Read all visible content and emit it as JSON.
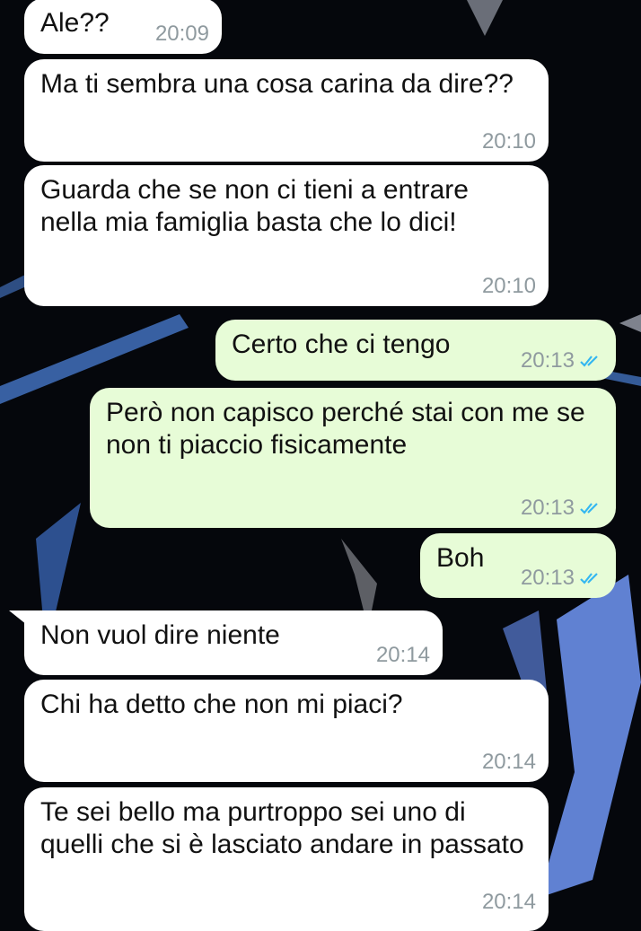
{
  "chat": {
    "messages": [
      {
        "id": "m1",
        "dir": "in",
        "text": "Ale??",
        "time": "20:09"
      },
      {
        "id": "m2",
        "dir": "in",
        "text": "Ma ti sembra una cosa carina da dire??",
        "time": "20:10"
      },
      {
        "id": "m3",
        "dir": "in",
        "text": "Guarda che se non ci tieni a entrare nella mia famiglia basta che lo dici!",
        "time": "20:10"
      },
      {
        "id": "m4",
        "dir": "out",
        "text": "Certo che ci tengo",
        "time": "20:13",
        "read": true
      },
      {
        "id": "m5",
        "dir": "out",
        "text": "Però non capisco perché stai con me se non ti piaccio fisicamente",
        "time": "20:13",
        "read": true
      },
      {
        "id": "m6",
        "dir": "out",
        "text": "Boh",
        "time": "20:13",
        "read": true
      },
      {
        "id": "m7",
        "dir": "in",
        "text": "Non vuol dire niente",
        "time": "20:14"
      },
      {
        "id": "m8",
        "dir": "in",
        "text": "Chi ha detto che non mi piaci?",
        "time": "20:14"
      },
      {
        "id": "m9",
        "dir": "in",
        "text": "Te sei bello ma purtroppo sei uno di quelli che si è lasciato andare in passato",
        "time": "20:14"
      }
    ]
  },
  "colors": {
    "background": "#05070c",
    "incoming_bubble": "#ffffff",
    "outgoing_bubble": "#e7fcd7",
    "timestamp": "#8f9a9f",
    "read_ticks": "#34b7f1",
    "wallpaper_accent": "#6a8fe8"
  }
}
